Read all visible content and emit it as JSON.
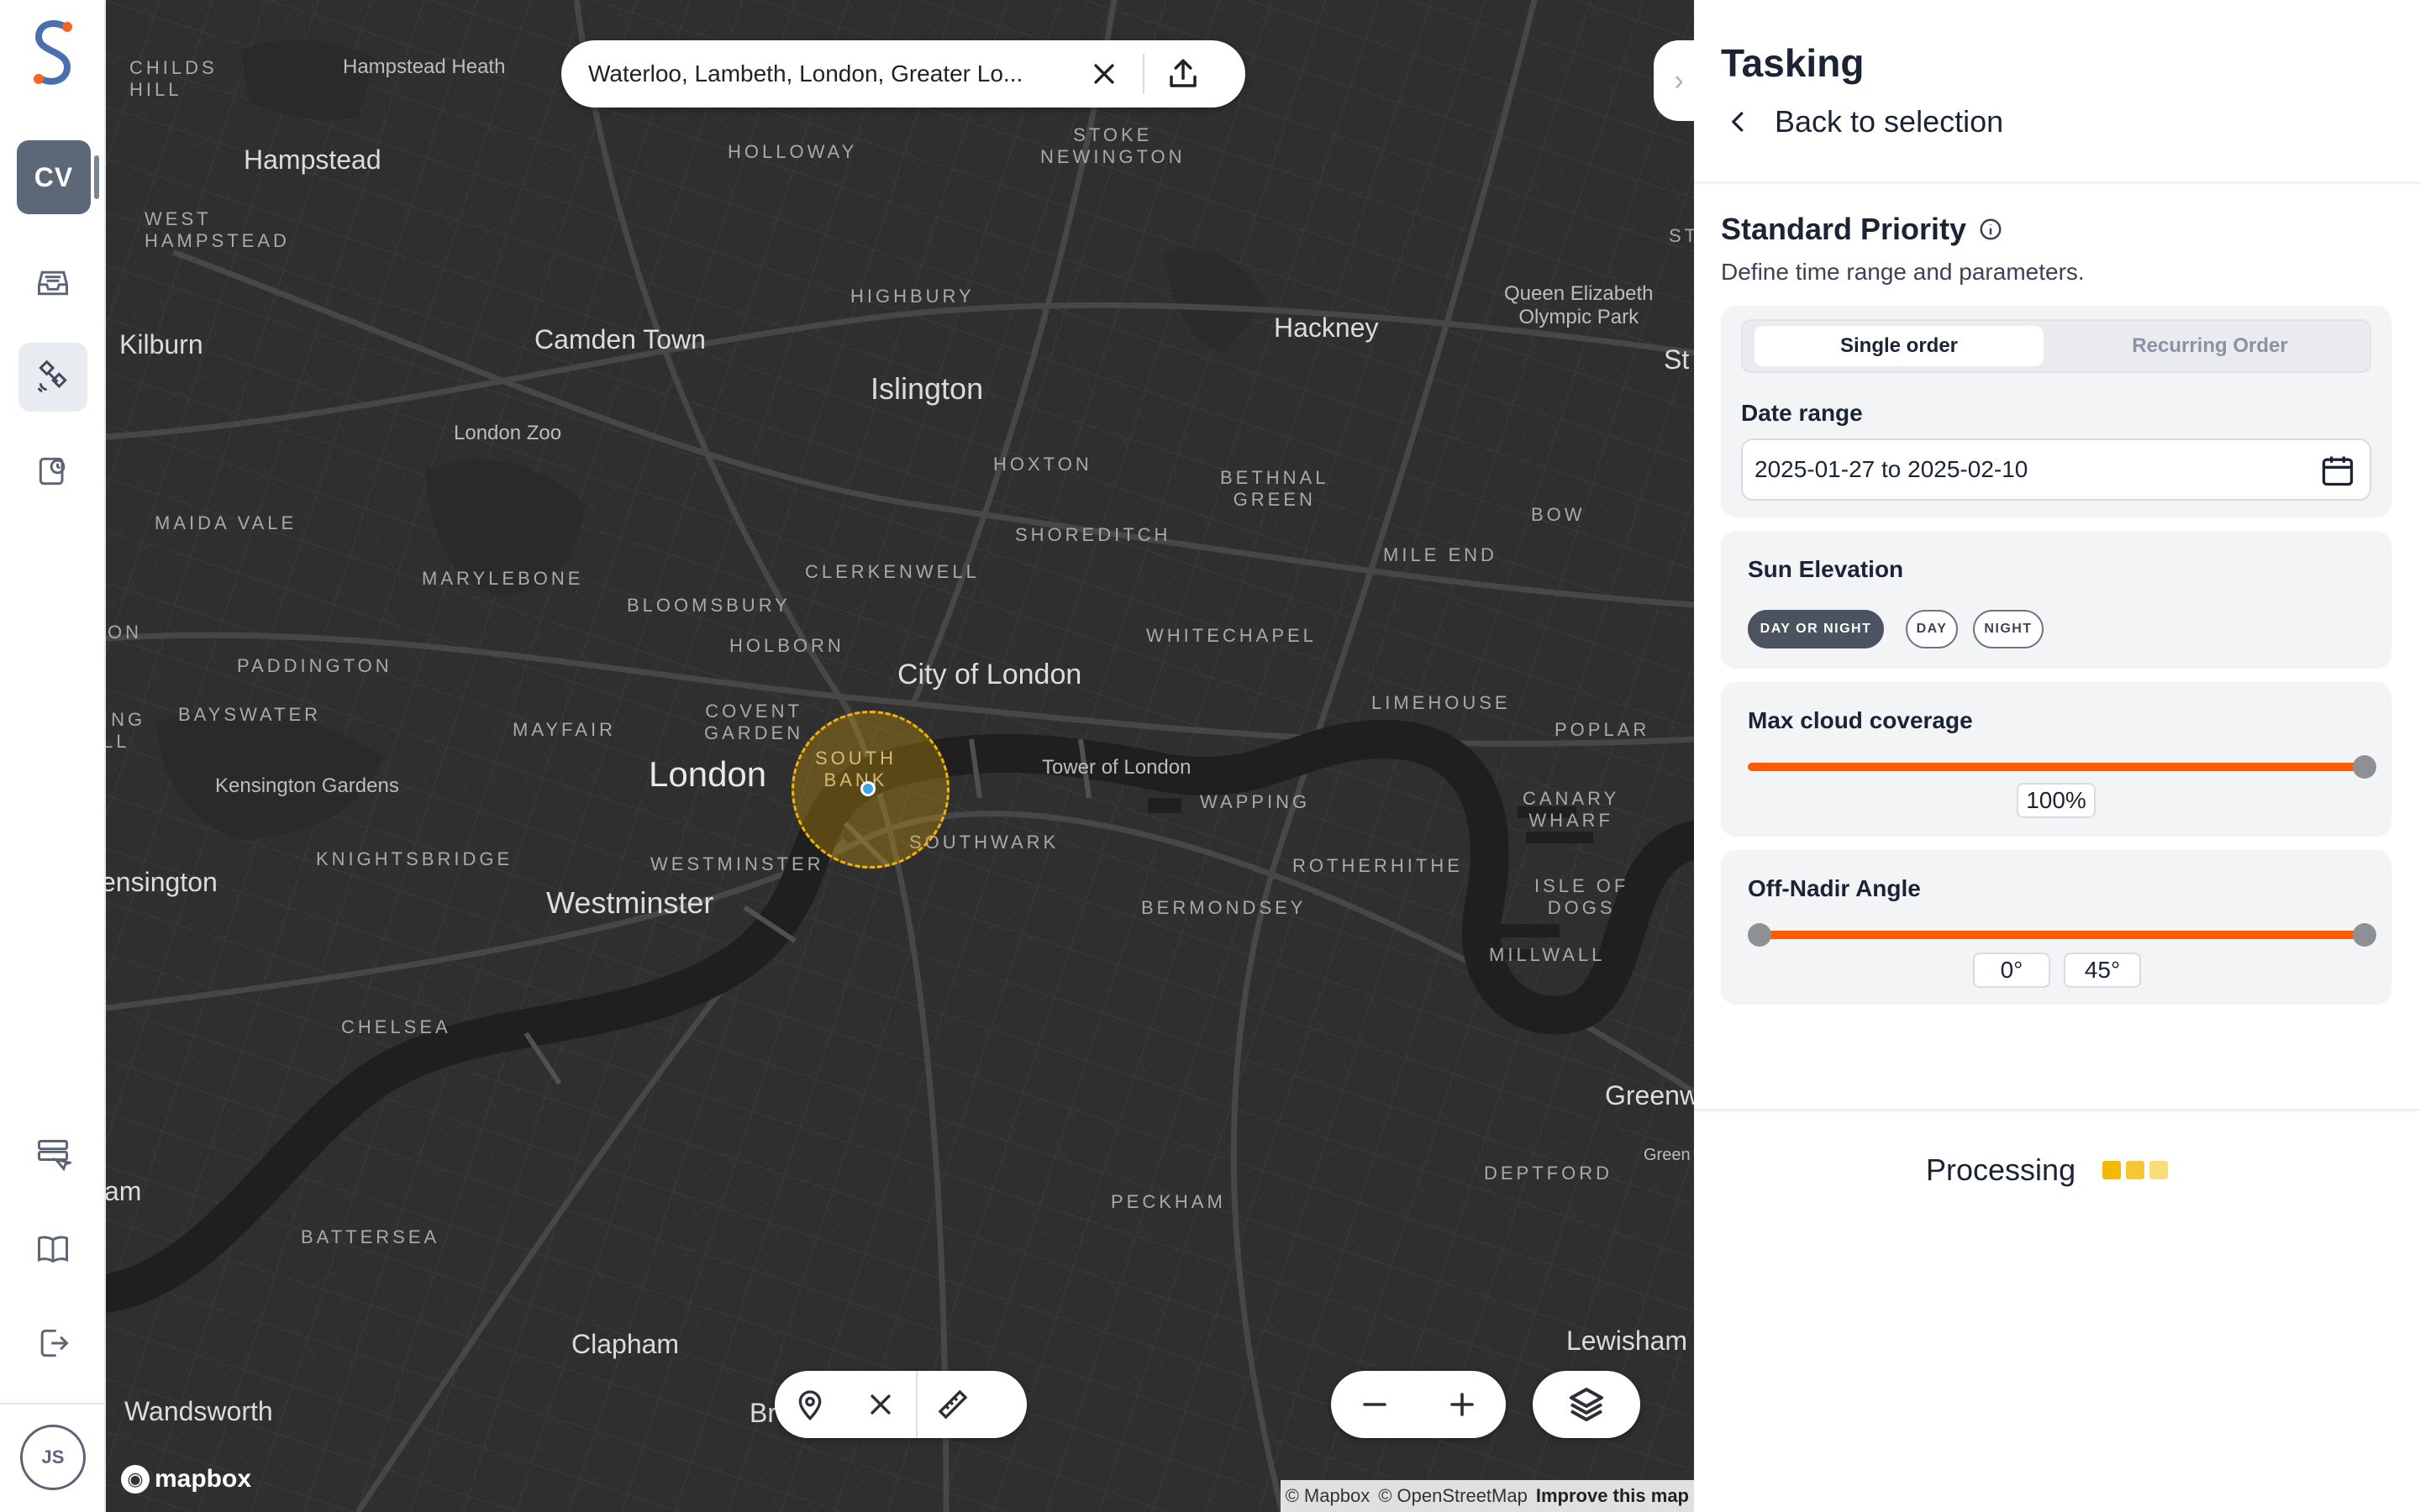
{
  "rail": {
    "org_initials": "CV",
    "user_initials": "JS",
    "icons": [
      "inbox-icon",
      "satellite-icon",
      "history-icon",
      "form-select-icon",
      "book-icon",
      "logout-icon"
    ]
  },
  "map": {
    "search_value": "Waterloo, Lambeth, London, Greater Lo...",
    "attribution_mapbox": "© Mapbox",
    "attribution_osm": "© OpenStreetMap",
    "attribution_improve": "Improve this map",
    "logo_text": "mapbox",
    "places": {
      "childs_hill": "CHILDS\nHILL",
      "hampstead_heath": "Hampstead Heath",
      "hampstead": "Hampstead",
      "west_hampstead": "WEST\nHAMPSTEAD",
      "kilburn": "Kilburn",
      "camden": "Camden Town",
      "holloway": "HOLLOWAY",
      "stoke_newington": "STOKE\nNEWINGTON",
      "highbury": "HIGHBURY",
      "hackney": "Hackney",
      "queen_elizabeth": "Queen Elizabeth\nOlympic Park",
      "islington": "Islington",
      "london_zoo": "London Zoo",
      "hoxton": "HOXTON",
      "bethnal_green": "BETHNAL\nGREEN",
      "bow": "BOW",
      "maida_vale": "MAIDA VALE",
      "shoreditch": "SHOREDITCH",
      "mile_end": "MILE END",
      "marylebone": "MARYLEBONE",
      "clerkenwell": "CLERKENWELL",
      "bloomsbury": "BLOOMSBURY",
      "whitechapel": "WHITECHAPEL",
      "holborn": "HOLBORN",
      "paddington": "PADDINGTON",
      "city_of_london": "City of London",
      "limehouse": "LIMEHOUSE",
      "poplar": "POPLAR",
      "bayswater": "BAYSWATER",
      "mayfair": "MAYFAIR",
      "covent_garden": "COVENT\nGARDEN",
      "south_bank": "SOUTH\nBANK",
      "tower_of_london": "Tower of London",
      "london": "London",
      "kensington_gardens": "Kensington Gardens",
      "wapping": "WAPPING",
      "canary_wharf": "CANARY\nWHARF",
      "southwark": "SOUTHWARK",
      "knightsbridge": "KNIGHTSBRIDGE",
      "westminster_caps": "WESTMINSTER",
      "rotherhithe": "ROTHERHITHE",
      "kensington": "ensington",
      "isle_of_dogs": "ISLE OF\nDOGS",
      "westminster": "Westminster",
      "bermondsey": "BERMONDSEY",
      "millwall": "MILLWALL",
      "chelsea": "CHELSEA",
      "greenwich": "Greenw",
      "greenwich_small": "Green",
      "deptford": "DEPTFORD",
      "peckham": "PECKHAM",
      "battersea": "BATTERSEA",
      "clapham": "Clapham",
      "lewisham": "Lewisham",
      "wandsworth": "Wandsworth",
      "brixton_partial": "Br",
      "st_partial": "St",
      "st_caps_partial": "ST",
      "ing_partial": "ING\nLL",
      "on_partial": "ON",
      "am_partial": "am"
    }
  },
  "panel": {
    "title": "Tasking",
    "back_label": "Back to selection",
    "priority_title": "Standard Priority",
    "priority_subtitle": "Define time range and parameters.",
    "order_tabs": [
      "Single order",
      "Recurring Order"
    ],
    "date_range_label": "Date range",
    "date_range_value": "2025-01-27 to 2025-02-10",
    "sun_elevation_label": "Sun Elevation",
    "sun_options": [
      "DAY OR NIGHT",
      "DAY",
      "NIGHT"
    ],
    "sun_selected": "DAY OR NIGHT",
    "cloud_label": "Max cloud coverage",
    "cloud_value": "100%",
    "cloud_fraction": 1.0,
    "nadir_label": "Off-Nadir Angle",
    "nadir_min": "0°",
    "nadir_max": "45°",
    "processing_label": "Processing"
  },
  "colors": {
    "accent_orange": "#ff5a00",
    "aoi_yellow": "#f2b400",
    "map_bg": "#2f2f2f",
    "processing_dot": "#f5b800"
  }
}
